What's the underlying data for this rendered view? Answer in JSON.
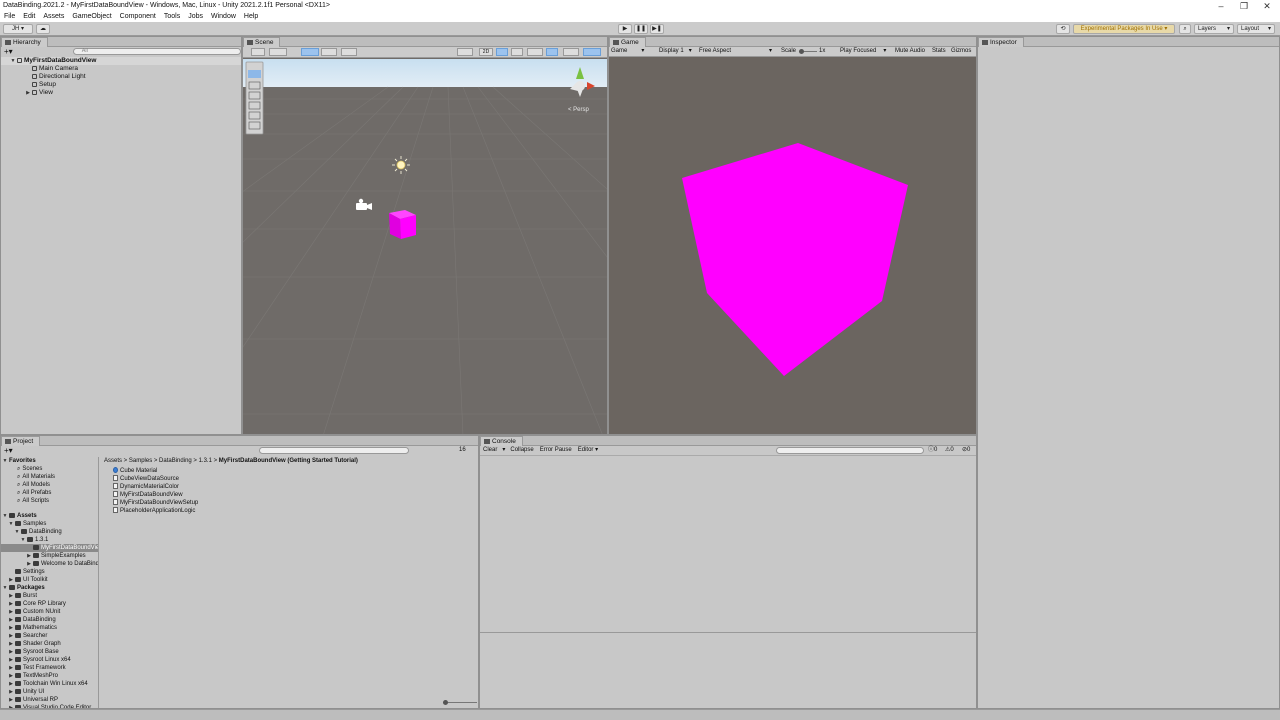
{
  "window": {
    "title": "DataBinding.2021.2 - MyFirstDataBoundView - Windows, Mac, Linux - Unity 2021.2.1f1 Personal <DX11>",
    "minimize": "–",
    "restore": "❐",
    "close": "✕"
  },
  "menu": [
    "File",
    "Edit",
    "Assets",
    "GameObject",
    "Component",
    "Tools",
    "Jobs",
    "Window",
    "Help"
  ],
  "toolbar": {
    "account": "JH ▾",
    "cloud": "☁",
    "play": "▶",
    "pause": "❚❚",
    "step": "▶❚",
    "history": "⟲",
    "experimental": "Experimental Packages In Use ▾",
    "search": "⌕",
    "layers": "Layers",
    "layout": "Layout"
  },
  "hierarchy": {
    "tab": "Hierarchy",
    "search_placeholder": "All",
    "scene": "MyFirstDataBoundView",
    "items": [
      "Main Camera",
      "Directional Light",
      "Setup",
      "View"
    ]
  },
  "scene": {
    "tab": "Scene",
    "persp": "< Persp",
    "btn_2d": "2D"
  },
  "game": {
    "tab": "Game",
    "mode": "Game",
    "display": "Display 1",
    "aspect": "Free Aspect",
    "scale_label": "Scale",
    "scale_value": "1x",
    "play_focused": "Play Focused",
    "mute": "Mute Audio",
    "stats": "Stats",
    "gizmos": "Gizmos"
  },
  "inspector": {
    "tab": "Inspector"
  },
  "project": {
    "tab": "Project",
    "count": "16",
    "breadcrumb": [
      "Assets",
      "Samples",
      "DataBinding",
      "1.3.1",
      "MyFirstDataBoundView (Getting Started Tutorial)"
    ],
    "favorites_label": "Favorites",
    "favorites": [
      "Scenes",
      "All Materials",
      "All Models",
      "All Prefabs",
      "All Scripts"
    ],
    "assets_label": "Assets",
    "asset_tree": [
      {
        "label": "Samples",
        "indent": 1,
        "tri": "▼"
      },
      {
        "label": "DataBinding",
        "indent": 2,
        "tri": "▼"
      },
      {
        "label": "1.3.1",
        "indent": 3,
        "tri": "▼"
      },
      {
        "label": "MyFirstDataBoundView",
        "indent": 4,
        "tri": "",
        "selected": true
      },
      {
        "label": "SimpleExamples",
        "indent": 4,
        "tri": "▶"
      },
      {
        "label": "Welcome to DataBinding",
        "indent": 4,
        "tri": "▶"
      },
      {
        "label": "Settings",
        "indent": 1,
        "tri": ""
      },
      {
        "label": "UI Toolkit",
        "indent": 1,
        "tri": "▶"
      }
    ],
    "packages_label": "Packages",
    "packages": [
      "Burst",
      "Core RP Library",
      "Custom NUnit",
      "DataBinding",
      "Mathematics",
      "Searcher",
      "Shader Graph",
      "Sysroot Base",
      "Sysroot Linux x64",
      "Test Framework",
      "TextMeshPro",
      "Toolchain Win Linux x64",
      "Unity UI",
      "Universal RP",
      "Visual Studio Code Editor"
    ],
    "files": [
      "Cube Material",
      "CubeViewDataSource",
      "DynamicMaterialColor",
      "MyFirstDataBoundView",
      "MyFirstDataBoundViewSetup",
      "PlaceholderApplicationLogic"
    ]
  },
  "console": {
    "tab": "Console",
    "clear": "Clear",
    "collapse": "Collapse",
    "error_pause": "Error Pause",
    "editor": "Editor",
    "count_info": "0",
    "count_warn": "0",
    "count_error": "0"
  },
  "colors": {
    "cube": "#ff00ff",
    "game_bg": "#6b6560",
    "scene_ground": "#6f6b68",
    "sky_top": "#c8dff0"
  }
}
